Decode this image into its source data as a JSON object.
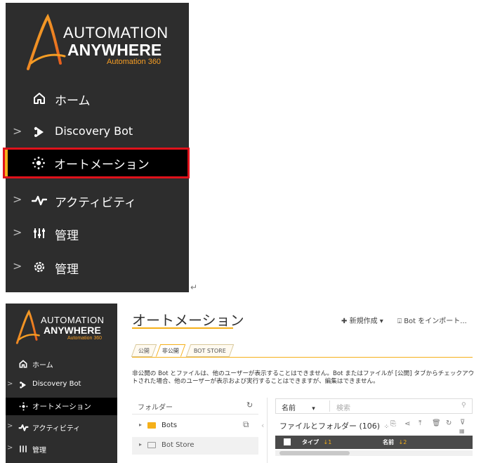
{
  "colors": {
    "sidebar_bg": "#2d2d2d",
    "active_bg": "#000000",
    "accent": "#f5b01a",
    "highlight_border": "#e0121b",
    "logo_orange": "#f59d24"
  },
  "logo": {
    "line1": "AUTOMATION",
    "line2": "ANYWHERE",
    "line3": "Automation 360"
  },
  "nav": {
    "home": {
      "label": "ホーム",
      "icon": "home-icon"
    },
    "discovery": {
      "label": "Discovery Bot",
      "icon": "discovery-bot-icon"
    },
    "automation": {
      "label": "オートメーション",
      "icon": "automation-dots-icon"
    },
    "activity": {
      "label": "アクティビティ",
      "icon": "pulse-icon"
    },
    "manage1": {
      "label": "管理",
      "icon": "sliders-icon"
    },
    "manage2": {
      "label": "管理",
      "icon": "gear-icon"
    }
  },
  "return_mark": "↵",
  "main": {
    "title": "オートメーション",
    "new_button": "新規作成",
    "import_button": "Bot をインポート..."
  },
  "tabs": [
    "公開",
    "非公開",
    "BOT STORE"
  ],
  "description": "非公開の Bot とファイルは、他のユーザーが表示することはできません。Bot またはファイルが [公開] タブからチェックアウトされた場合、他のユーザーが表示および実行することはできますが、編集はできません。",
  "folders": {
    "header": "フォルダー",
    "items": [
      {
        "name": "Bots"
      },
      {
        "name": "Bot Store"
      }
    ]
  },
  "file_panel": {
    "search_field": "名前",
    "search_placeholder": "検索",
    "files_label": "ファイルとフォルダー (106)",
    "columns": [
      {
        "label": "タイプ",
        "sort": "↓1"
      },
      {
        "label": "名前",
        "sort": "↓2"
      }
    ]
  }
}
